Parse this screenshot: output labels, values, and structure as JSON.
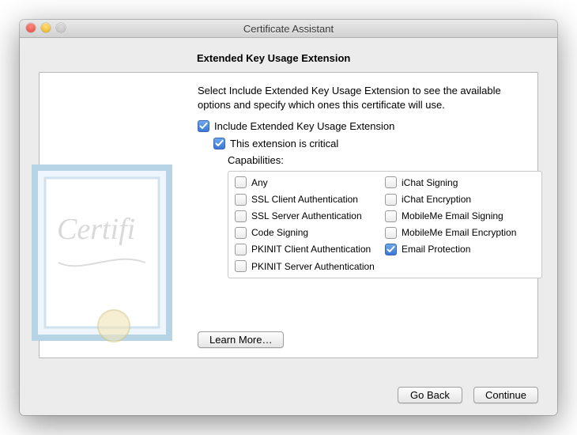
{
  "window": {
    "title": "Certificate Assistant"
  },
  "page": {
    "heading": "Extended Key Usage Extension",
    "intro": "Select Include Extended Key Usage Extension to see the available options and specify which ones this certificate will use."
  },
  "options": {
    "include_label": "Include Extended Key Usage Extension",
    "include_checked": true,
    "critical_label": "This extension is critical",
    "critical_checked": true,
    "capabilities_label": "Capabilities:"
  },
  "capabilities": {
    "left": [
      {
        "label": "Any",
        "checked": false
      },
      {
        "label": "SSL Client Authentication",
        "checked": false
      },
      {
        "label": "SSL Server Authentication",
        "checked": false
      },
      {
        "label": "Code Signing",
        "checked": false
      },
      {
        "label": "PKINIT Client Authentication",
        "checked": false
      },
      {
        "label": "PKINIT Server Authentication",
        "checked": false
      }
    ],
    "right": [
      {
        "label": "iChat Signing",
        "checked": false
      },
      {
        "label": "iChat Encryption",
        "checked": false
      },
      {
        "label": "MobileMe Email Signing",
        "checked": false
      },
      {
        "label": "MobileMe Email Encryption",
        "checked": false
      },
      {
        "label": "Email Protection",
        "checked": true
      }
    ]
  },
  "buttons": {
    "learn_more": "Learn More…",
    "go_back": "Go Back",
    "cont": "Continue"
  }
}
